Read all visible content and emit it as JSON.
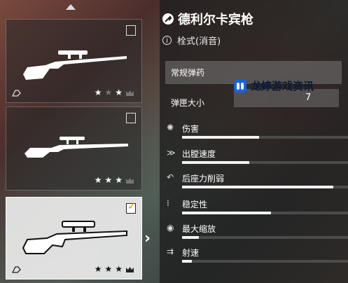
{
  "weapon": {
    "name": "德利尔卡宾枪",
    "action": "栓式(消音)"
  },
  "ammo": {
    "selected": "常规弹药"
  },
  "magazine": {
    "label": "弹匣大小",
    "value": "7"
  },
  "watermark": {
    "text": "龙婷游戏资讯"
  },
  "stats": [
    {
      "label": "伤害",
      "icon": "damage-icon",
      "fraction": 0.46
    },
    {
      "label": "出膛速度",
      "icon": "muzzle-velocity-icon",
      "fraction": 0.4
    },
    {
      "label": "后座力削弱",
      "icon": "recoil-icon",
      "fraction": 0.9
    },
    {
      "label": "稳定性",
      "icon": "stability-icon",
      "fraction": 0.53
    },
    {
      "label": "最大缩放",
      "icon": "zoom-icon",
      "fraction": 0.1
    },
    {
      "label": "射速",
      "icon": "fire-rate-icon",
      "fraction": 0.06
    }
  ],
  "loadouts": [
    {
      "stars": 2,
      "max_stars": 3,
      "selected": false,
      "checked": false
    },
    {
      "stars": 3,
      "max_stars": 3,
      "selected": false,
      "checked": false
    },
    {
      "stars": 3,
      "max_stars": 3,
      "selected": true,
      "checked": true
    }
  ],
  "colors": {
    "panel": "#1e1e1e",
    "bar_fill": "#f2f2f2",
    "check": "#d4a000",
    "watermark_logo": "#1565d8"
  }
}
